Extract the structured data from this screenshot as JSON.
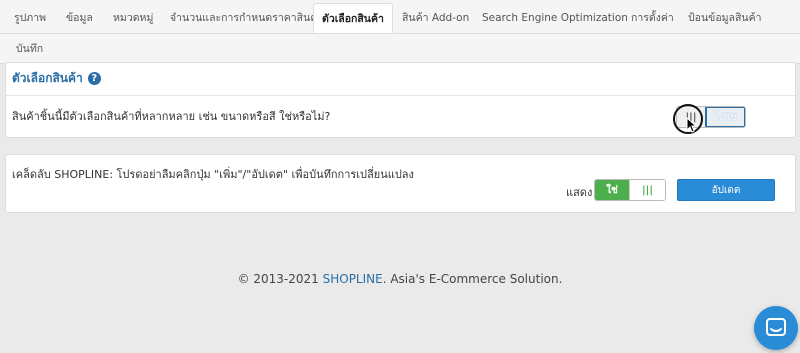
{
  "tabs": [
    {
      "label": "รูปภาพ"
    },
    {
      "label": "ข้อมูล"
    },
    {
      "label": "หมวดหมู่"
    },
    {
      "label": "จำนวนและการกำหนดราคาสินค้า"
    },
    {
      "label": "ตัวเลือกสินค้า",
      "active": true
    },
    {
      "label": "สินค้า Add-on"
    },
    {
      "label": "Search Engine Optimization"
    },
    {
      "label": "การตั้งค่า"
    },
    {
      "label": "ป้อนข้อมูลสินค้า"
    },
    {
      "label": "บันทึก"
    }
  ],
  "variants": {
    "title": "ตัวเลือกสินค้า",
    "question": "สินค้าชิ้นนี้มีตัวเลือกสินค้าที่หลากหลาย เช่น ขนาดหรือสี ใช่หรือไม่?",
    "toggle_yes_icon": "|||",
    "toggle_no": "ไม่ใช่"
  },
  "save_bar": {
    "tip": "เคล็ดลับ SHOPLINE: โปรดอย่าลืมคลิกปุ่ม \"เพิ่ม\"/\"อัปเดต\" เพื่อบันทึกการเปลี่ยนแปลง",
    "show_label": "แสดง",
    "show_yes": "ใช่",
    "show_no_icon": "|||",
    "update_button": "อัปเดต"
  },
  "footer": {
    "prefix": "© 2013-2021 ",
    "brand": "SHOPLINE",
    "suffix": ". Asia's E-Commerce Solution."
  },
  "colors": {
    "accent": "#2b6ea6",
    "success": "#4cae4c",
    "primary_button": "#2a8bd6"
  }
}
